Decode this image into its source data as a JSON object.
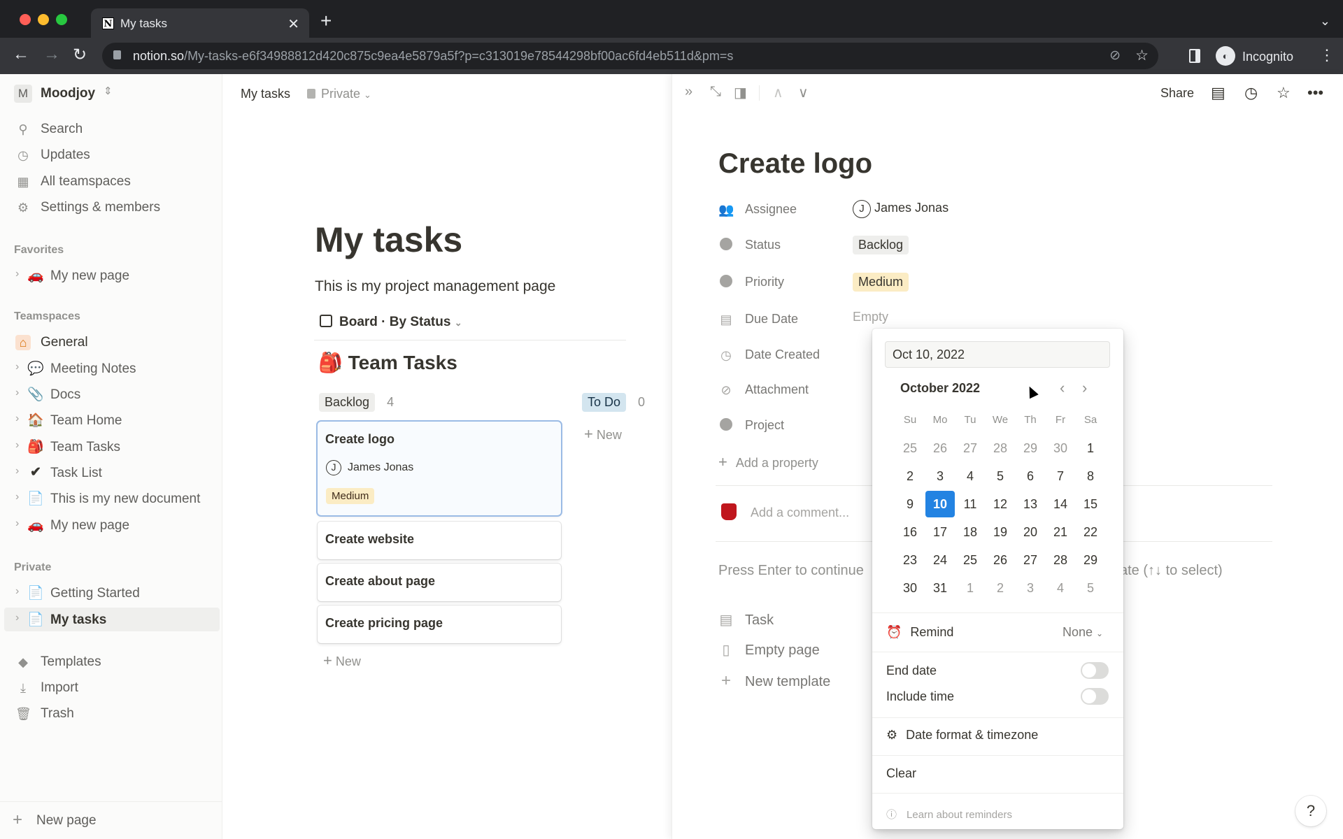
{
  "browser": {
    "tab_title": "My tasks",
    "tab_close": "✕",
    "new_tab": "+",
    "tab_list": "⌄",
    "url_host": "notion.so",
    "url_path": "/My-tasks-e6f34988812d420c875c9ea4e5879a5f?p=c313019e78544298bf00ac6fd4eb511d&pm=s",
    "profile": "Incognito"
  },
  "sidebar": {
    "workspace_badge": "M",
    "workspace_name": "Moodjoy",
    "nav": [
      {
        "label": "Search",
        "icon": "search-icon"
      },
      {
        "label": "Updates",
        "icon": "clock-icon"
      },
      {
        "label": "All teamspaces",
        "icon": "building-icon"
      },
      {
        "label": "Settings & members",
        "icon": "gear-icon"
      }
    ],
    "favorites_label": "Favorites",
    "favorites": [
      {
        "label": "My new page",
        "emoji": "🚗"
      }
    ],
    "teamspaces_label": "Teamspaces",
    "teamspace_general": "General",
    "teamspace_pages": [
      {
        "label": "Meeting Notes",
        "emoji": "💬"
      },
      {
        "label": "Docs",
        "emoji": "📎"
      },
      {
        "label": "Team Home",
        "emoji": "🏠"
      },
      {
        "label": "Team Tasks",
        "emoji": "🎒"
      },
      {
        "label": "Task List",
        "emoji": "✔"
      },
      {
        "label": "This is my new document",
        "emoji": "📄"
      },
      {
        "label": "My new page",
        "emoji": "🚗"
      }
    ],
    "private_label": "Private",
    "private_pages": [
      {
        "label": "Getting Started",
        "emoji": "📄"
      },
      {
        "label": "My tasks",
        "emoji": "📄",
        "selected": true
      }
    ],
    "bottom": [
      {
        "label": "Templates",
        "icon": "templates-icon"
      },
      {
        "label": "Import",
        "icon": "import-icon"
      },
      {
        "label": "Trash",
        "icon": "trash-icon"
      }
    ],
    "new_page": "New page"
  },
  "main": {
    "breadcrumb": "My tasks",
    "privacy": "Private",
    "title": "My tasks",
    "description": "This is my project management page",
    "view": "Board · By Status",
    "database_title": "Team Tasks",
    "database_emoji": "🎒",
    "groups": [
      {
        "label": "Backlog",
        "count": "4"
      },
      {
        "label": "To Do",
        "count": "0"
      }
    ],
    "cards": [
      {
        "title": "Create logo",
        "assignee": "James Jonas",
        "assignee_initial": "J",
        "priority": "Medium"
      },
      {
        "title": "Create website"
      },
      {
        "title": "Create about page"
      },
      {
        "title": "Create pricing page"
      }
    ],
    "new_label": "New"
  },
  "peek": {
    "share": "Share",
    "title": "Create logo",
    "properties": [
      {
        "label": "Assignee",
        "value": "James Jonas",
        "initial": "J"
      },
      {
        "label": "Status",
        "value": "Backlog"
      },
      {
        "label": "Priority",
        "value": "Medium"
      },
      {
        "label": "Due Date",
        "value": "Empty"
      },
      {
        "label": "Date Created",
        "value": ""
      },
      {
        "label": "Attachment",
        "value": ""
      },
      {
        "label": "Project",
        "value": ""
      }
    ],
    "add_property": "Add a property",
    "comment_placeholder": "Add a comment...",
    "press_enter": "Press Enter to continue",
    "press_enter_tail": "ate (↑↓ to select)",
    "templates": [
      {
        "label": "Task",
        "icon": "page-lines-icon"
      },
      {
        "label": "Empty page",
        "icon": "page-icon"
      },
      {
        "label": "New template",
        "icon": "plus-icon"
      }
    ]
  },
  "datepicker": {
    "input_value": "Oct 10, 2022",
    "month": "October 2022",
    "weekdays": [
      "Su",
      "Mo",
      "Tu",
      "We",
      "Th",
      "Fr",
      "Sa"
    ],
    "weeks": [
      [
        "25",
        "26",
        "27",
        "28",
        "29",
        "30",
        "1"
      ],
      [
        "2",
        "3",
        "4",
        "5",
        "6",
        "7",
        "8"
      ],
      [
        "9",
        "10",
        "11",
        "12",
        "13",
        "14",
        "15"
      ],
      [
        "16",
        "17",
        "18",
        "19",
        "20",
        "21",
        "22"
      ],
      [
        "23",
        "24",
        "25",
        "26",
        "27",
        "28",
        "29"
      ],
      [
        "30",
        "31",
        "1",
        "2",
        "3",
        "4",
        "5"
      ]
    ],
    "selected_day": "10",
    "remind_label": "Remind",
    "remind_value": "None",
    "end_date_label": "End date",
    "end_date_on": false,
    "include_time_label": "Include time",
    "include_time_on": false,
    "date_format_label": "Date format & timezone",
    "clear_label": "Clear",
    "learn_label": "Learn about reminders",
    "accent": "#2383e2"
  },
  "help": "?"
}
